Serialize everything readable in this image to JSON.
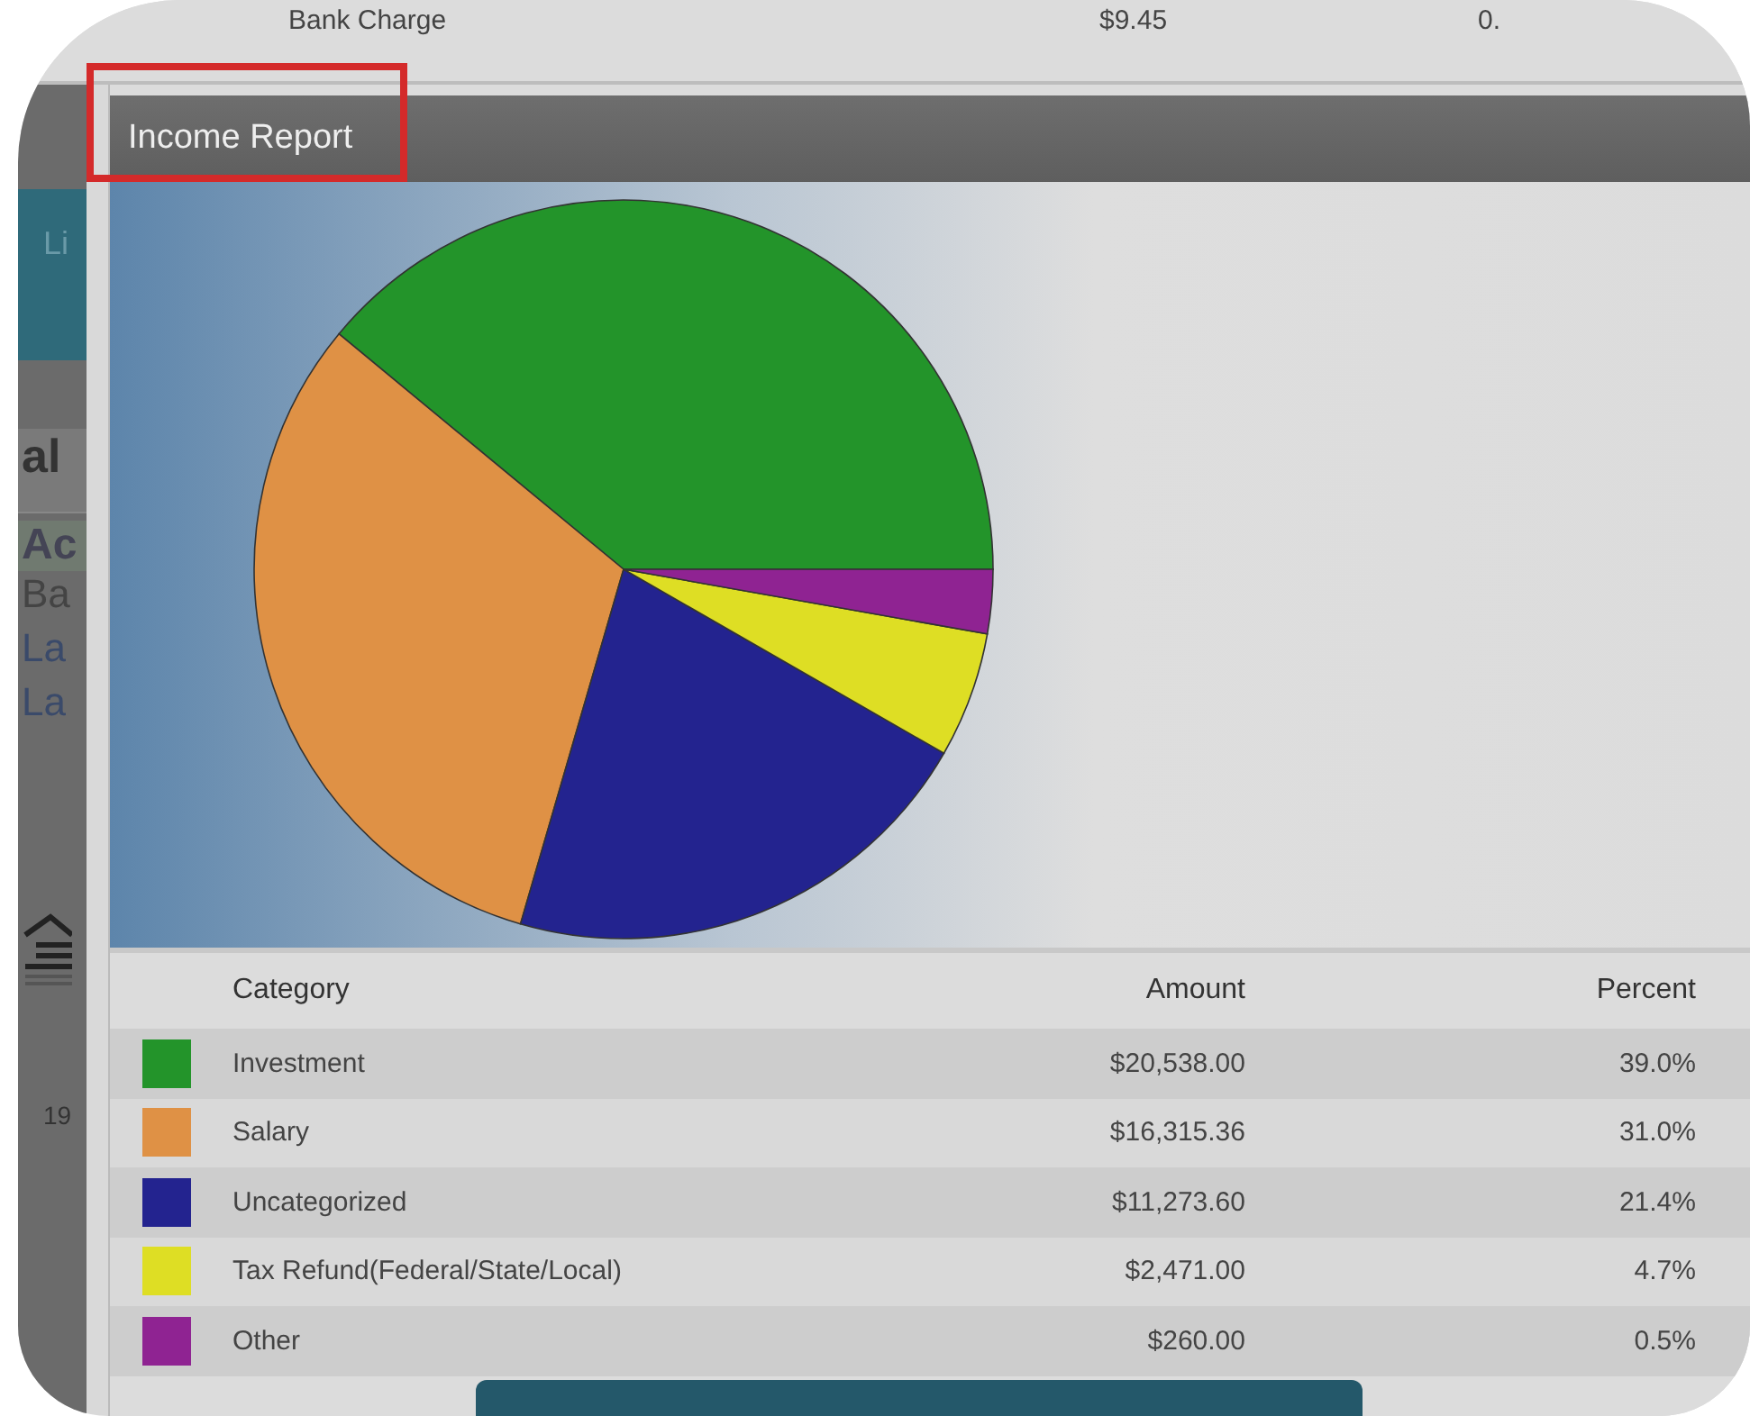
{
  "background_row": {
    "label": "Bank Charge",
    "amount": "$9.45",
    "column_3": "0."
  },
  "background_panel": {
    "fragments": [
      {
        "kind": "tab",
        "text": "Li"
      },
      {
        "kind": "heading",
        "text": "al"
      },
      {
        "kind": "bold",
        "text": "Ac"
      },
      {
        "kind": "plain",
        "text": "Ba"
      },
      {
        "kind": "link",
        "text": "La"
      },
      {
        "kind": "link",
        "text": "La"
      },
      {
        "kind": "logo"
      },
      {
        "kind": "plain",
        "text": "19"
      }
    ]
  },
  "dialog": {
    "title": "Income Report",
    "title_highlighted": true,
    "chart_data": {
      "type": "pie",
      "values": [
        39.0,
        31.5,
        21.2,
        5.5,
        2.8
      ]
    },
    "table": {
      "columns": [
        "Category",
        "Amount",
        "Percent"
      ],
      "rows": [
        {
          "category": "Investment",
          "amount": "$20,538.00",
          "percent": "39.0%",
          "color": "#23942a"
        },
        {
          "category": "Salary",
          "amount": "$16,315.36",
          "percent": "31.0%",
          "color": "#df9145"
        },
        {
          "category": "Uncategorized",
          "amount": "$11,273.60",
          "percent": "21.4%",
          "color": "#23238f"
        },
        {
          "category": "Tax Refund(Federal/State/Local)",
          "amount": "$2,471.00",
          "percent": "4.7%",
          "color": "#dede24"
        },
        {
          "category": "Other",
          "amount": "$260.00",
          "percent": "0.5%",
          "color": "#8f2392"
        }
      ]
    }
  }
}
